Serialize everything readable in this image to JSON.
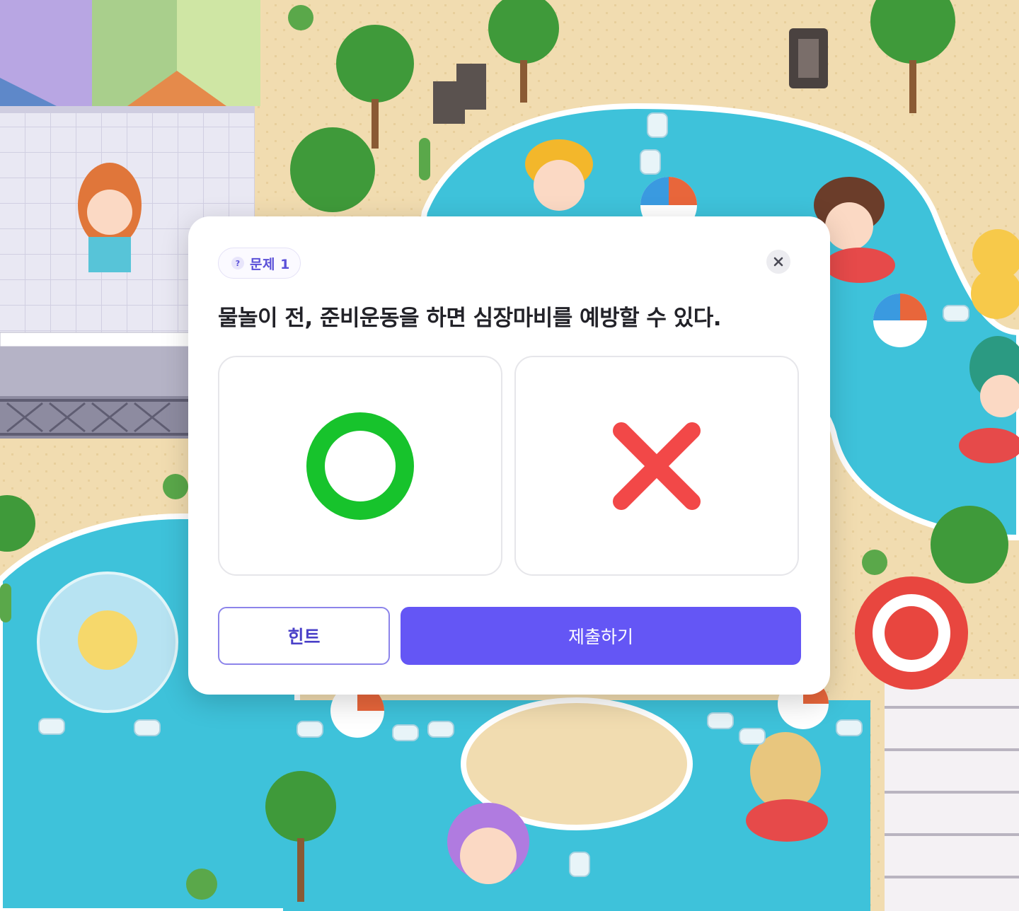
{
  "quiz": {
    "badge_label": "문제 1",
    "badge_icon": "question-icon",
    "question": "물놀이 전, 준비운동을 하면 심장마비를 예방할 수 있다.",
    "options": [
      {
        "id": "o",
        "icon": "circle-o-icon",
        "color": "#17c32c"
      },
      {
        "id": "x",
        "icon": "x-mark-icon",
        "color": "#f24848"
      }
    ],
    "hint_label": "힌트",
    "submit_label": "제출하기",
    "accent_color": "#6456f5"
  }
}
